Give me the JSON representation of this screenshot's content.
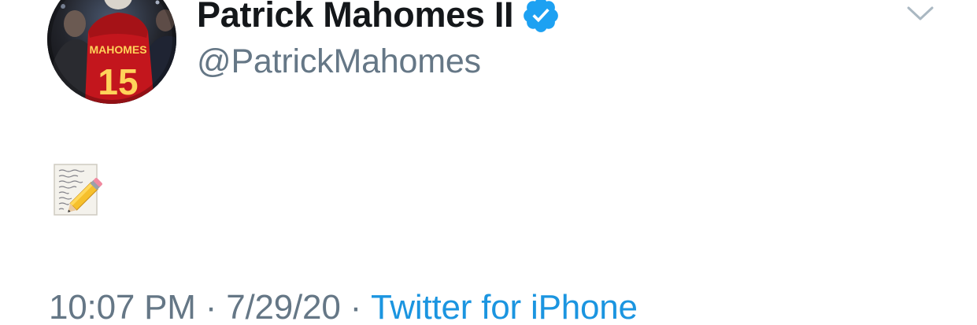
{
  "author": {
    "display_name": "Patrick Mahomes II",
    "handle": "@PatrickMahomes",
    "verified": true,
    "avatar_icon": "profile-photo",
    "jersey_text": "MAHOMES",
    "jersey_number": "15"
  },
  "tweet": {
    "body_emoji": "memo",
    "time": "10:07 PM",
    "separator": "·",
    "date": "7/29/20",
    "source": "Twitter for iPhone"
  },
  "colors": {
    "name": "#14171a",
    "secondary": "#657786",
    "link": "#1b95e0",
    "verified": "#1da1f2",
    "chevron": "#aab8c2"
  },
  "icons": {
    "verified": "verified-badge-icon",
    "more": "chevron-down-icon",
    "memo": "memo-icon"
  }
}
